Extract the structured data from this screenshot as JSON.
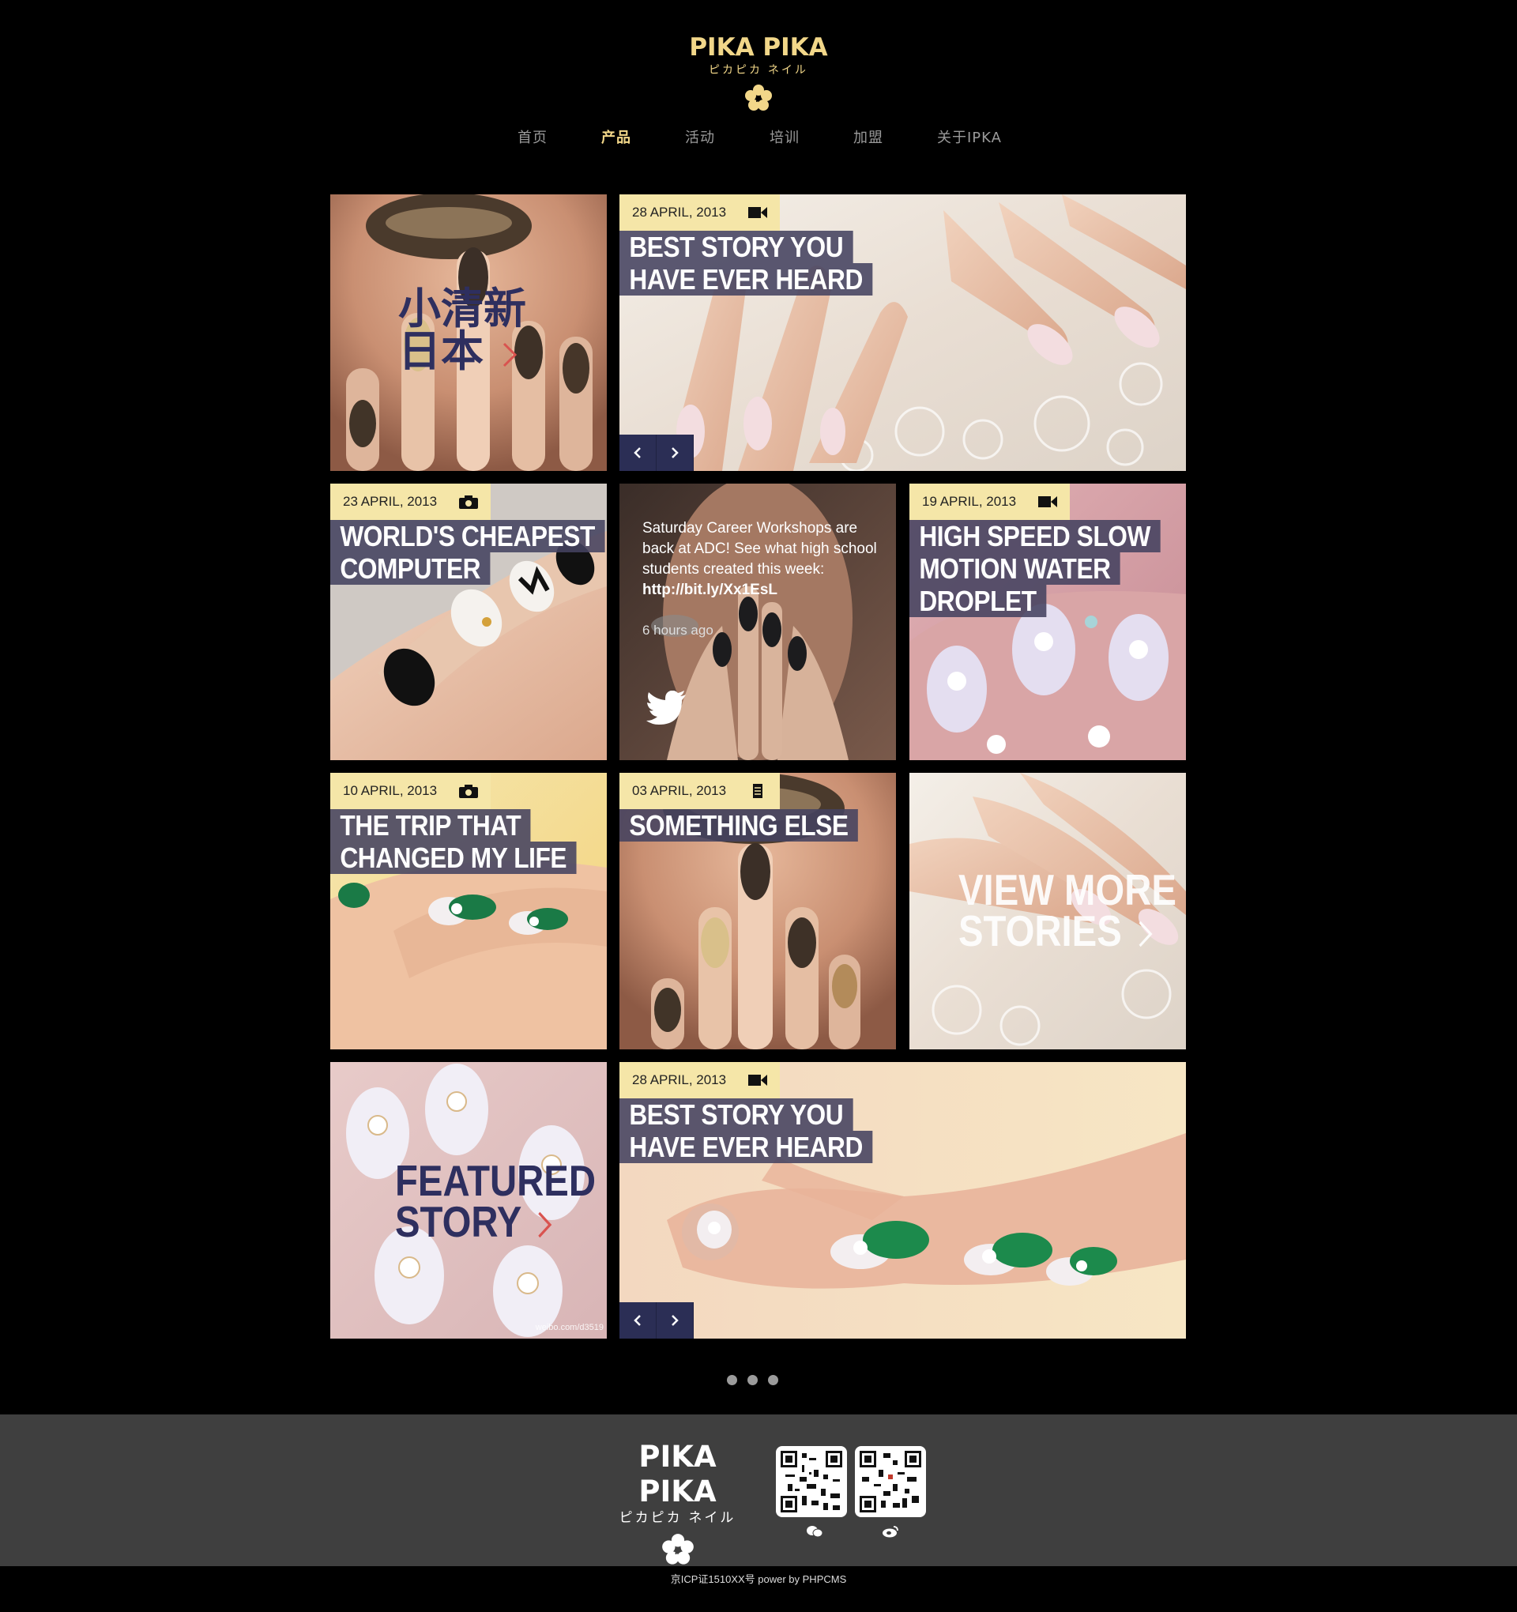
{
  "brand": {
    "name": "PIKA PIKA",
    "subtitle": "ピカピカ ネイル"
  },
  "nav": {
    "items": [
      "首页",
      "产品",
      "活动",
      "培训",
      "加盟",
      "关于IPKA"
    ],
    "active_index": 1
  },
  "tiles": {
    "feature_cn": {
      "line1": "小清新",
      "line2": "日本"
    },
    "story_top": {
      "date": "28 APRIL, 2013",
      "icon": "video-icon",
      "title_lines": [
        "BEST STORY YOU",
        "HAVE EVER HEARD"
      ]
    },
    "story_computer": {
      "date": "23 APRIL, 2013",
      "icon": "camera-icon",
      "title_lines": [
        "WORLD'S CHEAPEST",
        "COMPUTER"
      ]
    },
    "tweet": {
      "text": "Saturday Career Workshops are back at ADC! See what high school students created this week:",
      "link": "http://bit.ly/Xx1EsL",
      "time": "6 hours ago",
      "icon": "twitter-icon"
    },
    "story_droplet": {
      "date": "19 APRIL, 2013",
      "icon": "video-icon",
      "title_lines": [
        "HIGH SPEED SLOW",
        "MOTION WATER",
        "DROPLET"
      ]
    },
    "story_trip": {
      "date": "10 APRIL, 2013",
      "icon": "camera-icon",
      "title_lines": [
        "THE TRIP THAT",
        "CHANGED MY LIFE"
      ]
    },
    "story_else": {
      "date": "03 APRIL, 2013",
      "icon": "document-icon",
      "title_lines": [
        "SOMETHING ELSE"
      ]
    },
    "view_more": {
      "line1": "VIEW MORE",
      "line2": "STORIES"
    },
    "featured": {
      "line1": "FEATURED",
      "line2": "STORY",
      "watermark": "weibo.com/d3519"
    },
    "story_bottom": {
      "date": "28 APRIL, 2013",
      "icon": "video-icon",
      "title_lines": [
        "BEST STORY YOU",
        "HAVE EVER HEARD"
      ]
    }
  },
  "pager": {
    "count": 3
  },
  "footer": {
    "brand_name": "PIKA PIKA",
    "brand_subtitle": "ピカピカ ネイル",
    "qr_codes": [
      {
        "icon": "wechat-icon"
      },
      {
        "icon": "weibo-icon"
      }
    ],
    "copyright": "京ICP证1510XX号  power by PHPCMS"
  },
  "colors": {
    "background": "#000000",
    "accent_gold": "#f2d789",
    "date_tag": "#f5e6a8",
    "title_block": "#444260",
    "arrow_button": "#2b2e55",
    "feature_text": "#2e2f5f",
    "chevron_red": "#d9534f",
    "footer": "#3f3f3f"
  }
}
